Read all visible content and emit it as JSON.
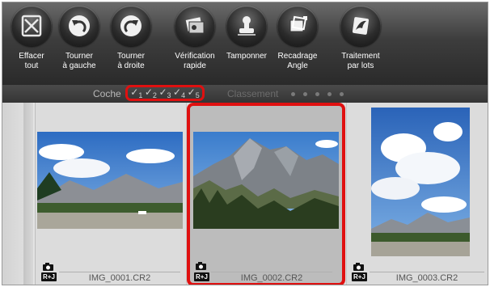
{
  "toolbar": {
    "buttons": [
      {
        "label": "Effacer\ntout",
        "icon": "erase-icon"
      },
      {
        "label": "Tourner\nà gauche",
        "icon": "rotate-left-icon"
      },
      {
        "label": "Tourner\nà droite",
        "icon": "rotate-right-icon"
      },
      {
        "label": "Vérification\nrapide",
        "icon": "quick-check-icon"
      },
      {
        "label": "Tamponner",
        "icon": "stamp-icon"
      },
      {
        "label": "Recadrage\nAngle",
        "icon": "crop-angle-icon"
      },
      {
        "label": "Traitement\npar lots",
        "icon": "batch-process-icon"
      }
    ]
  },
  "filter": {
    "coche_label": "Coche",
    "checks": [
      "1",
      "2",
      "3",
      "4",
      "5"
    ],
    "classement_label": "Classement"
  },
  "thumbnails": [
    {
      "name": "IMG_0001.CR2",
      "badge": "R+J",
      "selected": false
    },
    {
      "name": "IMG_0002.CR2",
      "badge": "R+J",
      "selected": true
    },
    {
      "name": "IMG_0003.CR2",
      "badge": "R+J",
      "selected": false
    }
  ],
  "colors": {
    "highlight": "#e01010",
    "toolbar_bg": "#3d3d3d",
    "sky": "#3b78c8"
  }
}
